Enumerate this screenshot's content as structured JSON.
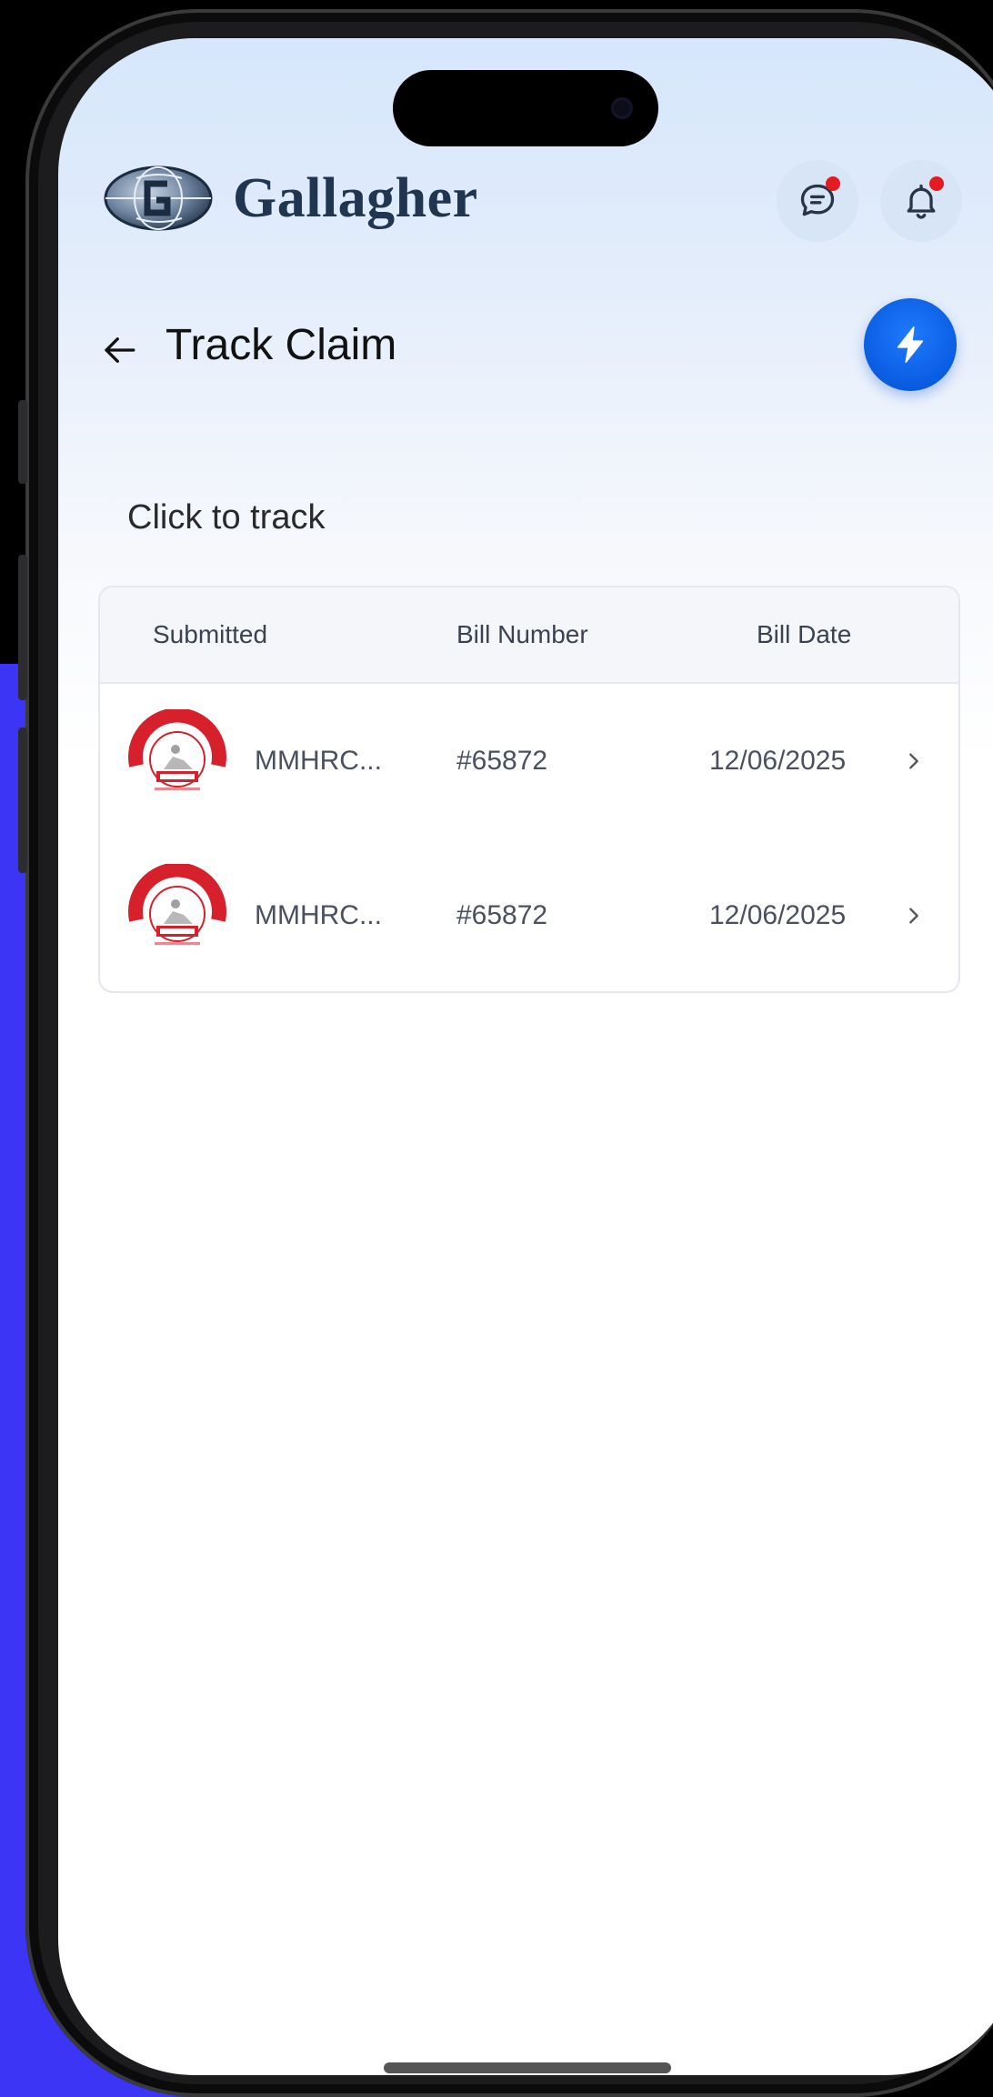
{
  "header": {
    "brand": "Gallagher",
    "messages_icon": "chat-icon",
    "notifications_icon": "bell-icon"
  },
  "page": {
    "title": "Track Claim",
    "subtitle": "Click to track"
  },
  "table": {
    "columns": [
      "Submitted",
      "Bill Number",
      "Bill Date"
    ],
    "rows": [
      {
        "provider": "MMHRC...",
        "bill_number": "#65872",
        "bill_date": "12/06/2025"
      },
      {
        "provider": "MMHRC...",
        "bill_number": "#65872",
        "bill_date": "12/06/2025"
      }
    ]
  },
  "colors": {
    "accent": "#0a5ce0",
    "brand_text": "#1f3550",
    "notification_dot": "#e31b23",
    "background_side": "#3d35f5"
  }
}
